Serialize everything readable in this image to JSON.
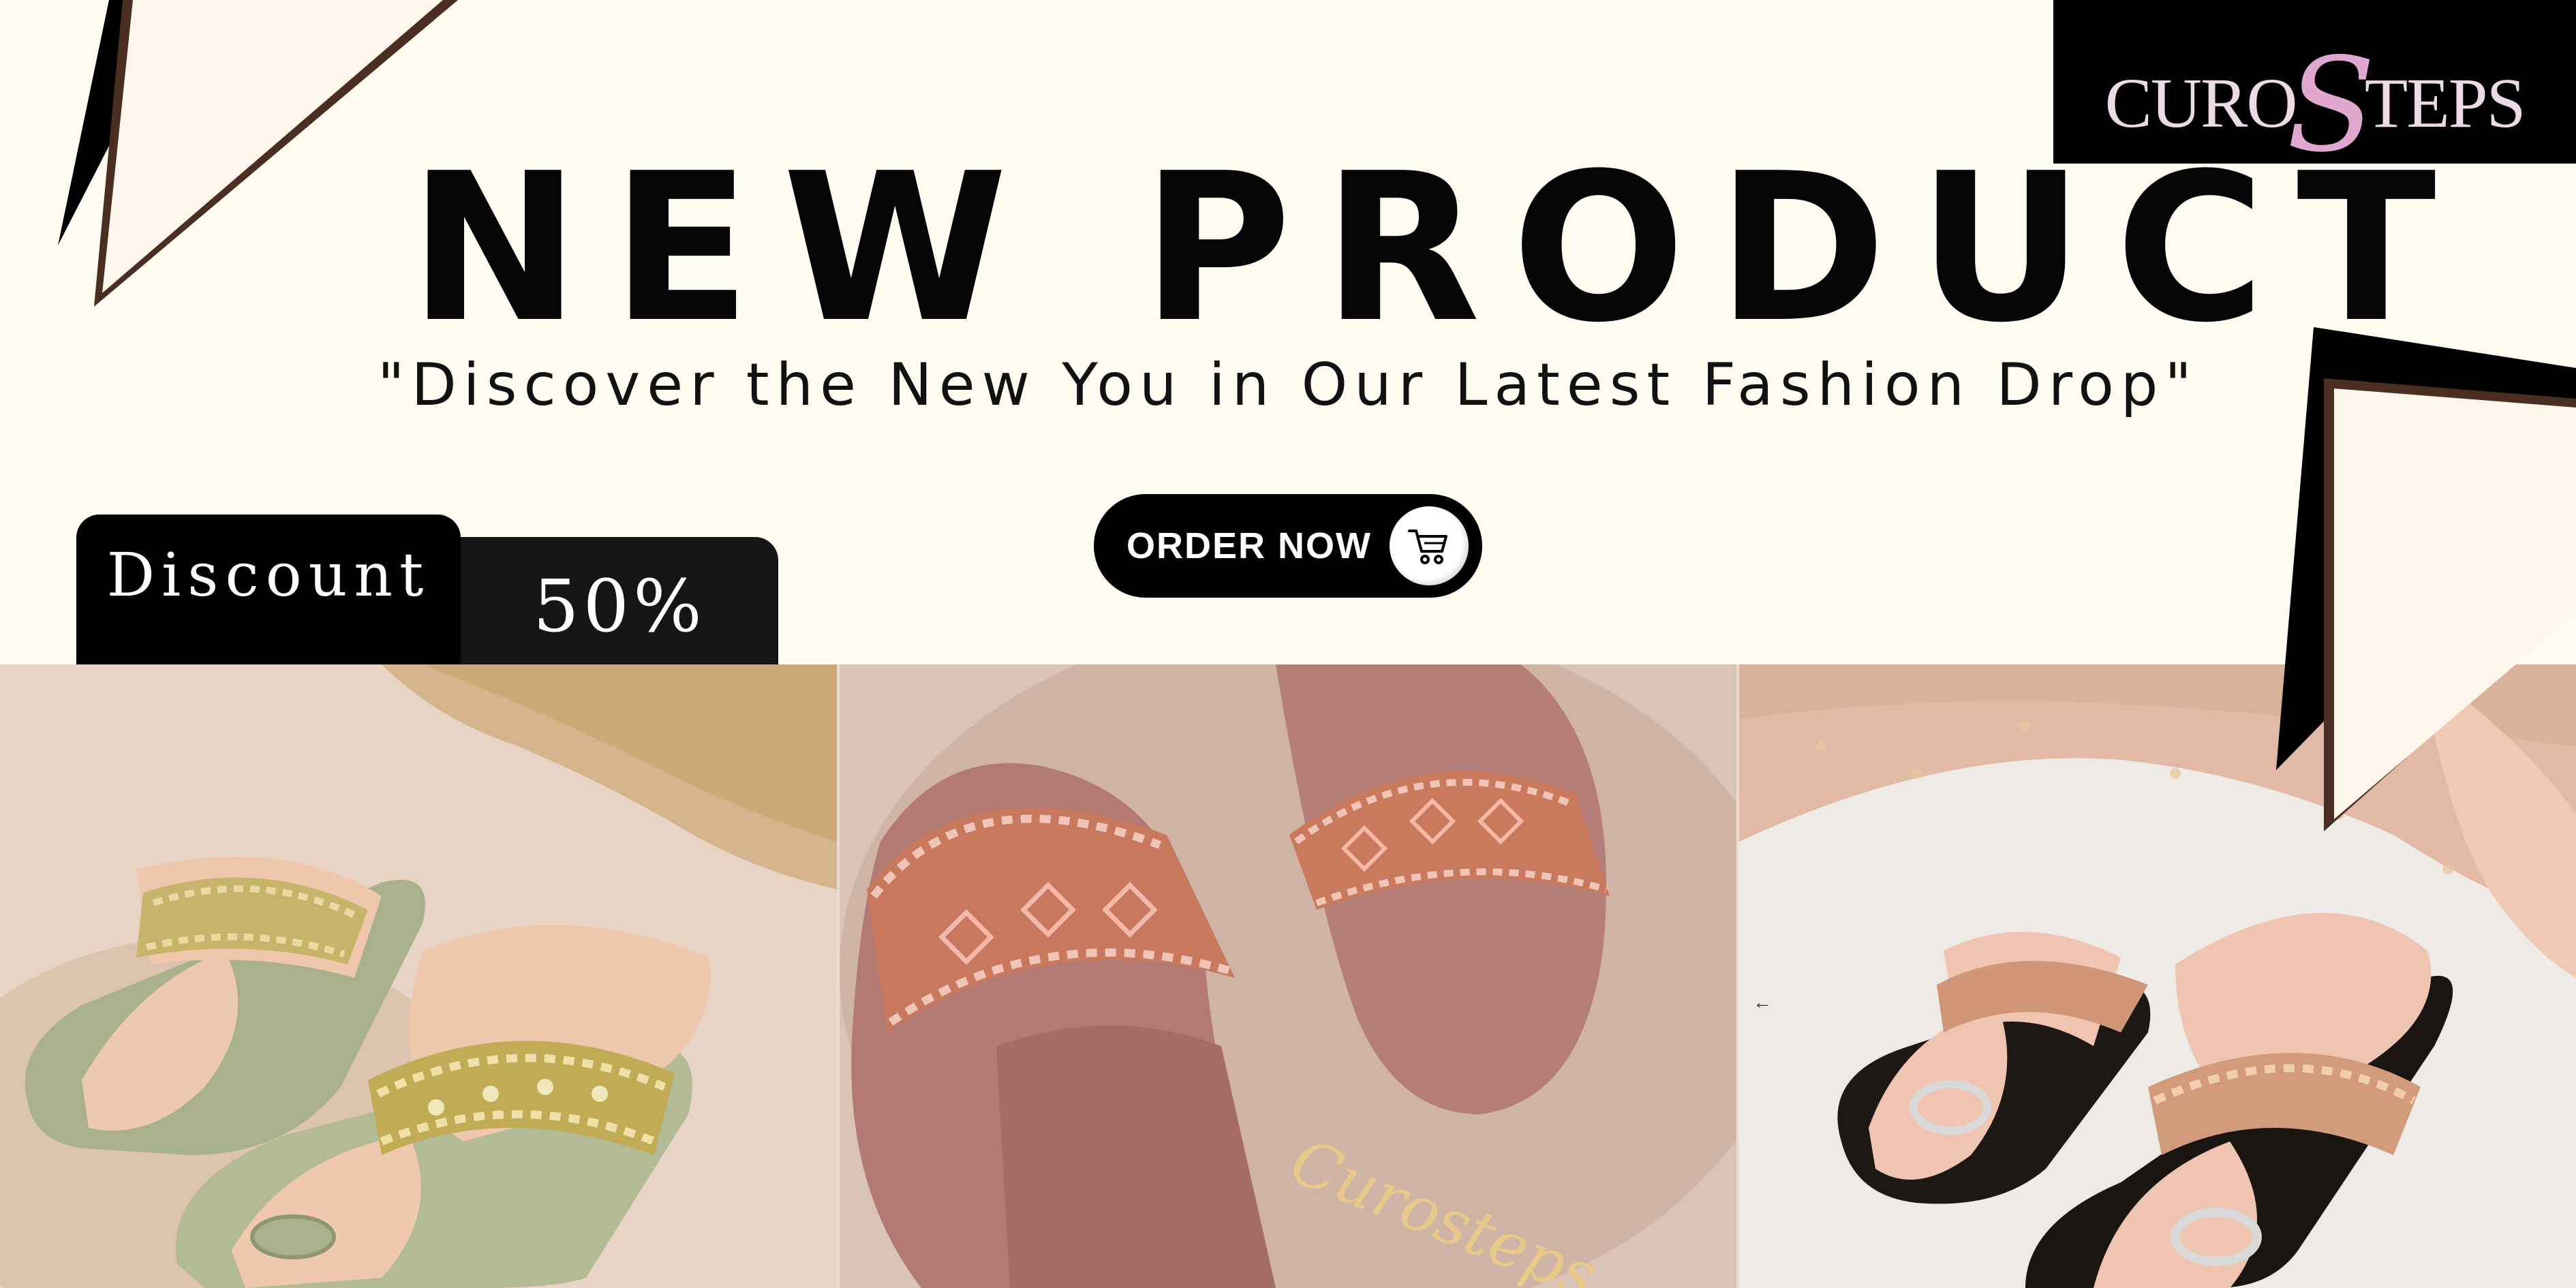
{
  "brand": {
    "logo_text_left": "CURO",
    "logo_text_mid": "S",
    "logo_text_right": "TEPS",
    "script_mark": "Curosteps"
  },
  "hero": {
    "headline": "NEW PRODUCT",
    "tagline": "\"Discover the New You in Our Latest Fashion Drop\""
  },
  "cta": {
    "label": "ORDER NOW",
    "icon": "cart-icon"
  },
  "discount": {
    "label": "Discount",
    "value": "50%"
  },
  "photos": {
    "items": [
      {
        "name": "olive-embroidered-toe-ring-flat",
        "colors": [
          "#a9b18c",
          "#c7b36a"
        ]
      },
      {
        "name": "pink-embroidered-slide",
        "colors": [
          "#b97f78",
          "#d79a86"
        ]
      },
      {
        "name": "black-rose-gold-toe-ring-flat",
        "colors": [
          "#1b1512",
          "#d19a7a"
        ]
      }
    ],
    "nav_arrow": "←"
  },
  "colors": {
    "background": "#fefcf1",
    "accent_dark": "#000000",
    "accent_brown": "#4b2e22",
    "logo_pink": "#e1a8cf"
  }
}
